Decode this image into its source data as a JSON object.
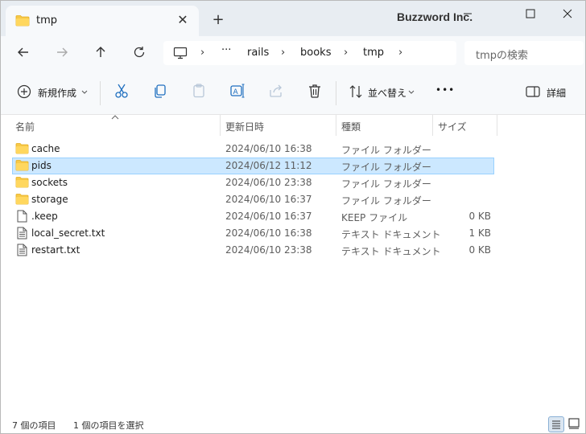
{
  "tab": {
    "title": "tmp",
    "close": "✕"
  },
  "new_tab": "+",
  "brand": "Buzzword Inc.",
  "breadcrumb": {
    "more": "···",
    "items": [
      "rails",
      "books",
      "tmp"
    ],
    "sep": "›"
  },
  "search": {
    "placeholder": "tmpの検索"
  },
  "toolbar": {
    "new_label": "新規作成",
    "sort_label": "並べ替え",
    "more": "•••",
    "details_label": "詳細"
  },
  "columns": {
    "name": "名前",
    "date": "更新日時",
    "type": "種類",
    "size": "サイズ"
  },
  "files": [
    {
      "name": "cache",
      "date": "2024/06/10 16:38",
      "type": "ファイル フォルダー",
      "size": "",
      "icon": "folder-icon",
      "selected": false
    },
    {
      "name": "pids",
      "date": "2024/06/12 11:12",
      "type": "ファイル フォルダー",
      "size": "",
      "icon": "folder-icon",
      "selected": true
    },
    {
      "name": "sockets",
      "date": "2024/06/10 23:38",
      "type": "ファイル フォルダー",
      "size": "",
      "icon": "folder-icon",
      "selected": false
    },
    {
      "name": "storage",
      "date": "2024/06/10 16:37",
      "type": "ファイル フォルダー",
      "size": "",
      "icon": "folder-icon",
      "selected": false
    },
    {
      "name": ".keep",
      "date": "2024/06/10 16:37",
      "type": "KEEP ファイル",
      "size": "0 KB",
      "icon": "file-icon",
      "selected": false
    },
    {
      "name": "local_secret.txt",
      "date": "2024/06/10 16:38",
      "type": "テキスト ドキュメント",
      "size": "1 KB",
      "icon": "text-file-icon",
      "selected": false
    },
    {
      "name": "restart.txt",
      "date": "2024/06/10 23:38",
      "type": "テキスト ドキュメント",
      "size": "0 KB",
      "icon": "text-file-icon",
      "selected": false
    }
  ],
  "status": {
    "count": "7 個の項目",
    "selected": "1 個の項目を選択"
  },
  "colors": {
    "folder": "#f7c948",
    "folder_dark": "#e5ad1e",
    "selection": "#cce8ff",
    "selection_border": "#99d1ff"
  }
}
